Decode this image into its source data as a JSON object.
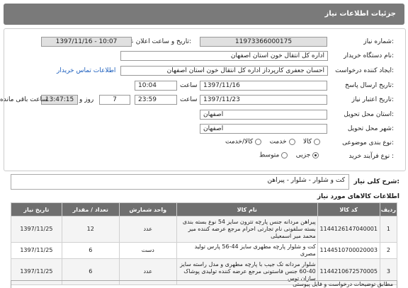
{
  "header": {
    "title": "جزئیات اطلاعات نیاز"
  },
  "form": {
    "need_number_label": "شماره نیاز:",
    "need_number": "11973366000175",
    "announce_label": "تاریخ و ساعت اعلان عمومی:",
    "announce_value": "1397/11/16 - 10:07",
    "buyer_label": "نام دستگاه خریدار:",
    "buyer_value": "اداره کل انتقال خون استان اصفهان",
    "creator_label": "ایجاد کننده درخواست:",
    "creator_value": "احسان جعفری کارپرداز اداره کل انتقال خون استان اصفهان",
    "contact_link": "اطلاعات تماس خریدار",
    "send_date_label": "تاریخ ارسال پاسخ:",
    "send_date": "1397/11/16",
    "send_time_label": "ساعت",
    "send_time": "10:04",
    "validity_label": "تاریخ اعتبار نیاز:",
    "validity_date": "1397/11/23",
    "validity_time_label": "ساعت",
    "validity_time": "23:59",
    "days_value": "7",
    "days_label": "روز و",
    "remaining_time": "13:47:15",
    "remaining_label": "ساعت باقی مانده",
    "province_label": "استان محل تحویل:",
    "province_value": "اصفهان",
    "city_label": "شهر محل تحویل:",
    "city_value": "اصفهان",
    "category_label": "نوع بندی موضوعی:",
    "category_options": [
      "کالا",
      "خدمت",
      "کالا/خدمت"
    ],
    "purchase_label": "نوع فرآیند خرید :",
    "purchase_options": [
      "جزیی",
      "متوسط"
    ]
  },
  "summary": {
    "label": "شرح کلی نیاز:",
    "value": "کت و شلوار - شلوار - پیراهن"
  },
  "goods": {
    "title": "اطلاعات کالاهای مورد نیاز",
    "columns": [
      "ردیف",
      "کد کالا",
      "نام کالا",
      "واحد شمارش",
      "تعداد / مقدار",
      "تاریخ نیاز"
    ],
    "rows": [
      {
        "row": "1",
        "code": "1144126147040001",
        "name": "پیراهن مردانه جنس پارچه تترون سایز 54 نوع بسته بندی بسته سلفونی نام تجارتی احرام مرجع عرضه کننده میر محمد میر اسمعیلی",
        "unit": "عدد",
        "qty": "12",
        "date": "1397/11/25"
      },
      {
        "row": "2",
        "code": "1144510700020003",
        "name": "کت و شلوار پارچه مطهری سایز 44-56 پارس تولید مصری",
        "unit": "دست",
        "qty": "6",
        "date": "1397/11/25"
      },
      {
        "row": "3",
        "code": "1144210672570005",
        "name": "شلوار مردانه تک جیب با پارچه مطهری و مدل راسته سایز 40-60 جنس فاستونی مرجع عرضه کننده تولیدی پوشاک سازان توس",
        "unit": "عدد",
        "qty": "6",
        "date": "1397/11/25"
      }
    ]
  },
  "notes": {
    "label": "مطابق توضیحات درخواست و فایل پیوستی"
  }
}
